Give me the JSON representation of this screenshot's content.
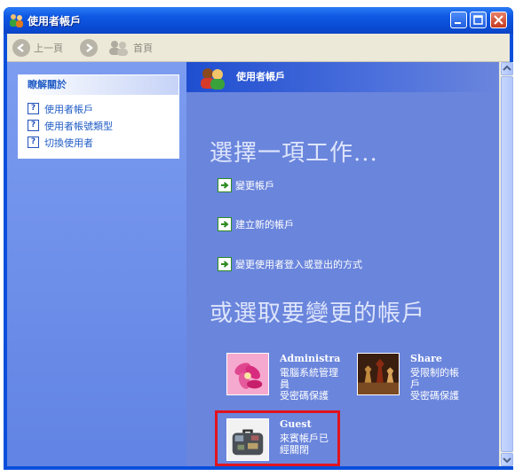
{
  "window": {
    "title": "使用者帳戶"
  },
  "toolbar": {
    "back_label": "上一頁",
    "home_label": "首頁"
  },
  "sidebar": {
    "title": "瞭解關於",
    "items": [
      {
        "label": "使用者帳戶"
      },
      {
        "label": "使用者帳號類型"
      },
      {
        "label": "切換使用者"
      }
    ]
  },
  "main": {
    "header_title": "使用者帳戶",
    "heading_tasks": "選擇一項工作...",
    "tasks": [
      {
        "label": "變更帳戶"
      },
      {
        "label": "建立新的帳戶"
      },
      {
        "label": "變更使用者登入或登出的方式"
      }
    ],
    "heading_accounts": "或選取要變更的帳戶",
    "accounts": [
      {
        "name": "Administrator",
        "lines": [
          "電腦系統管理",
          "員",
          "受密碼保護"
        ],
        "picture": "flower"
      },
      {
        "name": "Share",
        "lines": [
          "受限制的帳",
          "戶",
          "受密碼保護"
        ],
        "picture": "chess"
      },
      {
        "name": "Guest",
        "lines": [
          "來賓帳戶已",
          "經關閉"
        ],
        "picture": "briefcase"
      }
    ]
  },
  "colors": {
    "selection_outline": "#e0141e",
    "task_pane": "#6a85dc",
    "title_bar": "#0a4fdc"
  }
}
